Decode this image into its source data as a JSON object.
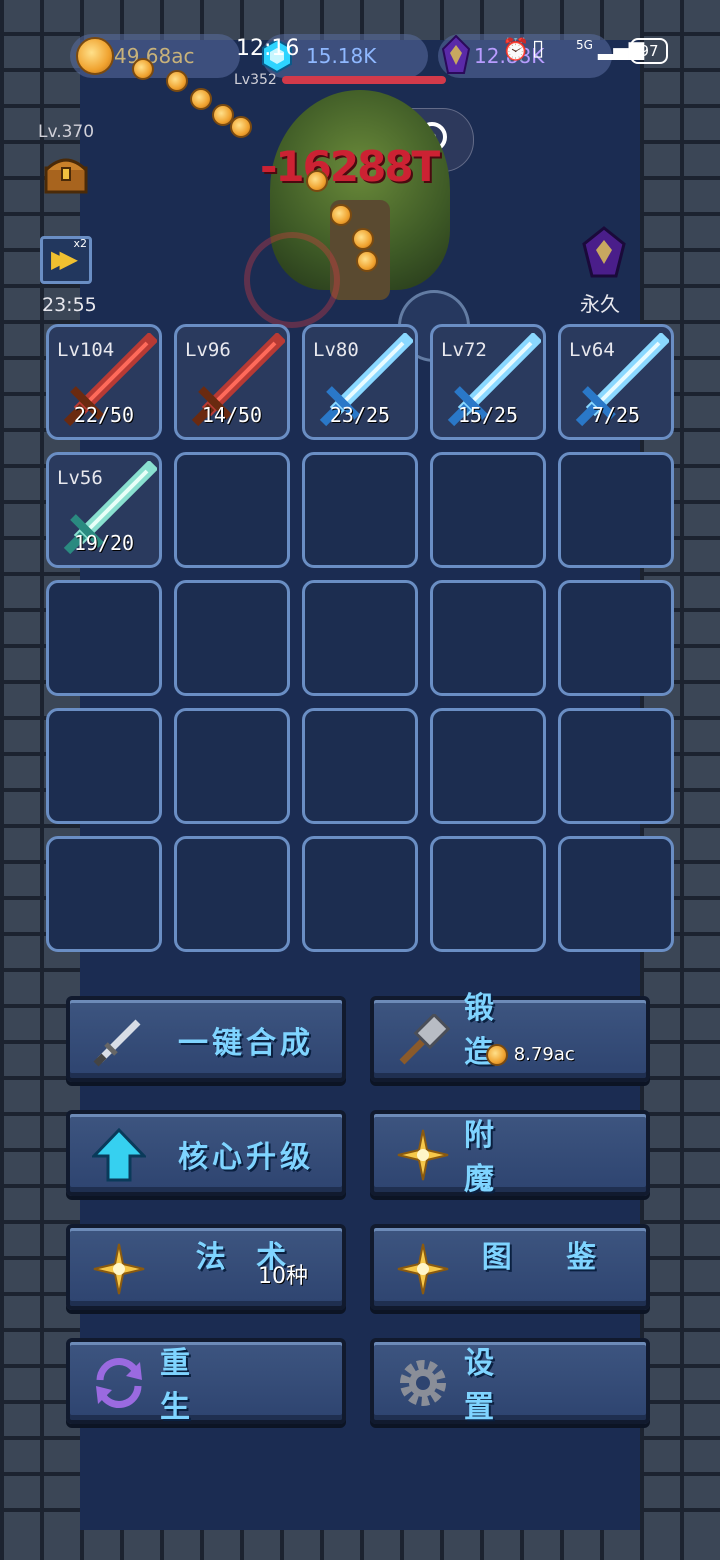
{
  "status": {
    "time": "12:16",
    "signal": "5G",
    "battery": "97"
  },
  "resources": {
    "gold": "49.68ac",
    "gems": "15.18K",
    "crystals": "12.88K"
  },
  "boss": {
    "level": "Lv352",
    "damage": "-16288T"
  },
  "player": {
    "level": "Lv.370",
    "speed_badge": "x2",
    "speed_timer": "23:55",
    "crystal_duration": "永久"
  },
  "colors": {
    "accent": "#7fd4ff",
    "slot_border": "#6a8ec4",
    "gold": "#f0a330",
    "damage": "#cc2233"
  },
  "slots": [
    {
      "level": "Lv104",
      "count": "22/50",
      "sword": "red"
    },
    {
      "level": "Lv96",
      "count": "14/50",
      "sword": "red"
    },
    {
      "level": "Lv80",
      "count": "23/25",
      "sword": "ice"
    },
    {
      "level": "Lv72",
      "count": "15/25",
      "sword": "ice"
    },
    {
      "level": "Lv64",
      "count": "7/25",
      "sword": "ice"
    },
    {
      "level": "Lv56",
      "count": "19/20",
      "sword": "jade"
    }
  ],
  "buttons": {
    "merge": {
      "label": "一键合成",
      "icon": "sword-icon"
    },
    "forge": {
      "label": "锻 造",
      "cost": "8.79ac",
      "icon": "hammer-icon"
    },
    "core_upgrade": {
      "label": "核心升级",
      "icon": "up-arrow-icon"
    },
    "enchant": {
      "label": "附 魔",
      "icon": "sparkle-icon"
    },
    "spells": {
      "label": "法 术",
      "sub": "10种",
      "icon": "sparkle-icon"
    },
    "codex": {
      "label": "图 鉴",
      "icon": "sparkle-icon"
    },
    "rebirth": {
      "label": "重 生",
      "icon": "refresh-icon"
    },
    "settings": {
      "label": "设 置",
      "icon": "gear-icon"
    }
  }
}
